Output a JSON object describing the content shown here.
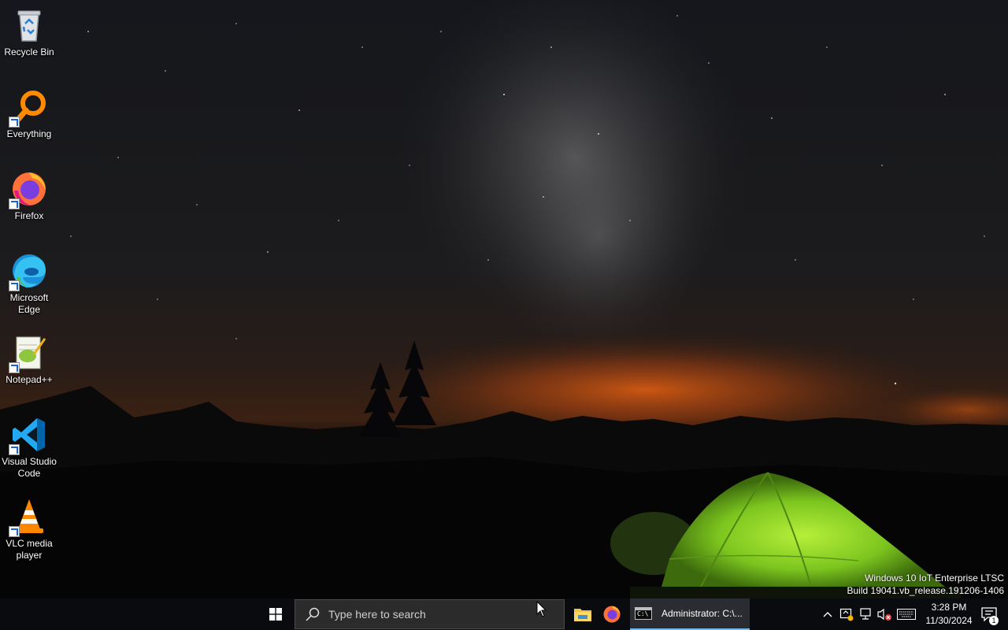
{
  "desktop": {
    "icons": [
      {
        "label": "Recycle Bin",
        "icon": "recycle-bin-icon",
        "shortcut": false
      },
      {
        "label": "Everything",
        "icon": "everything-search-icon",
        "shortcut": true
      },
      {
        "label": "Firefox",
        "icon": "firefox-icon",
        "shortcut": true
      },
      {
        "label": "Microsoft Edge",
        "icon": "edge-icon",
        "shortcut": true
      },
      {
        "label": "Notepad++",
        "icon": "notepad-plus-plus-icon",
        "shortcut": true
      },
      {
        "label": "Visual Studio Code",
        "icon": "vscode-icon",
        "shortcut": true
      },
      {
        "label": "VLC media player",
        "icon": "vlc-icon",
        "shortcut": true
      }
    ],
    "watermark": {
      "line1": "Windows 10 IoT Enterprise LTSC",
      "line2": "Build 19041.vb_release.191206-1406"
    }
  },
  "taskbar": {
    "search_placeholder": "Type here to search",
    "pinned": [
      {
        "icon": "file-explorer-icon"
      },
      {
        "icon": "firefox-icon"
      }
    ],
    "active_window": {
      "icon": "command-prompt-icon",
      "label": "Administrator: C:\\..."
    },
    "tray": {
      "time": "3:28 PM",
      "date": "11/30/2024",
      "notification_count": "1"
    }
  },
  "colors": {
    "taskbar_bg": "#090b0f",
    "search_bg": "#2b2b2b",
    "active_underline": "#76b9ed",
    "tent_green": "#8bd62a"
  }
}
